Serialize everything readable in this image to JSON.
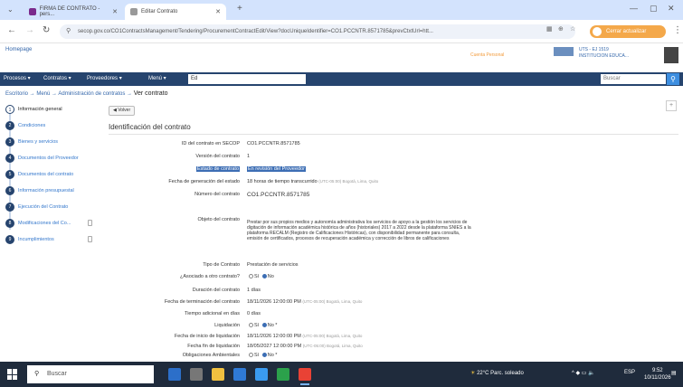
{
  "browser": {
    "tabs": [
      {
        "label": "FIRMA DE CONTRATO - pers...",
        "active": false
      },
      {
        "label": "Editar Contrato",
        "active": true
      }
    ],
    "url": "secop.gov.co/CO1ContractsManagement/Tendering/ProcurementContractEdit/View?docUniqueIdentifier=CO1.PCCNTR.8571785&prevCtxtUrl=htt...",
    "profile_label": "Cerrar actualizar",
    "accent": "#f4a84a"
  },
  "secop": {
    "logo": "Homepage",
    "user_lines": [
      "UTS - EJ 1519",
      "INSTITUCION EDUCA..."
    ],
    "user_links": "Cuenta Personal"
  },
  "nav": {
    "items": [
      "Procesos",
      "Contratos",
      "Proveedores",
      "Menú"
    ],
    "search_value": "Ed",
    "buscar_placeholder": "Buscar",
    "color": "#26446e"
  },
  "breadcrumb": {
    "trail": "Escritorio → Menú → Administración de contratos →",
    "current": "Ver contrato"
  },
  "sidebar": {
    "steps": [
      {
        "n": "1",
        "label": "Información general",
        "active": true,
        "locked": false
      },
      {
        "n": "2",
        "label": "Condiciones",
        "active": false,
        "locked": false
      },
      {
        "n": "3",
        "label": "Bienes y servicios",
        "active": false,
        "locked": false
      },
      {
        "n": "4",
        "label": "Documentos del Proveedor",
        "active": false,
        "locked": false
      },
      {
        "n": "5",
        "label": "Documentos del contrato",
        "active": false,
        "locked": false
      },
      {
        "n": "6",
        "label": "Información presupuestal",
        "active": false,
        "locked": false
      },
      {
        "n": "7",
        "label": "Ejecución del Contrato",
        "active": false,
        "locked": false
      },
      {
        "n": "8",
        "label": "Modificaciones del Co...",
        "active": false,
        "locked": true
      },
      {
        "n": "9",
        "label": "Incumplimientos",
        "active": false,
        "locked": true
      }
    ]
  },
  "main": {
    "back_label": "Volver",
    "collapse_symbol": "+",
    "section_title": "Identificación del contrato",
    "fields": {
      "id_k": "ID del contrato en SECOP",
      "id_v": "CO1.PCCNTR.8571785",
      "version_k": "Versión del contrato",
      "version_v": "1",
      "estado_k": "Estado de contrato",
      "estado_v": "En revisión del Proveedor",
      "fecha_gen_k": "Fecha de generación del estado",
      "fecha_gen_v": "18 horas de tiempo transcurrido",
      "fecha_gen_hint": "(UTC-05:00) Bogotá, Lima, Quito",
      "numero_k": "Número del contrato",
      "numero_v": "CO1.PCCNTR.8571785",
      "objeto_k": "Objeto del contrato",
      "objeto_v": "Prestar por sus propios medios y autonomía administrativa los servicios de apoyo a la gestión los servicios de digitación de información académica histórica de años (historiales) 2017 a 2022 desde la plataforma SNIES a la plataforma RECALM (Registro de Calificaciones Históricas), con disponibilidad permanente para consulta, emisión de certificados, procesos de recuperación académica y corrección de libros de calificaciones",
      "tipo_k": "Tipo de Contrato",
      "tipo_v": "Prestación de servicios",
      "asociado_k": "¿Asociado a otro contrato?",
      "asociado_si": "Sí",
      "asociado_no": "No",
      "duracion_k": "Duración del contrato",
      "duracion_v": "1 días",
      "fecha_term_k": "Fecha de terminación del contrato",
      "fecha_term_v": "18/11/2026 12:00:00 PM",
      "fecha_term_hint": "(UTC-05:00) Bogotá, Lima, Quito",
      "tiempo_k": "Tiempo adicional en días",
      "tiempo_v": "0 días",
      "liquid_k": "Liquidación",
      "liquid_si": "Sí",
      "liquid_no": "No *",
      "fecha_ini_liq_k": "Fecha de inicio de liquidación",
      "fecha_ini_liq_v": "18/11/2026 12:00:00 PM",
      "fecha_ini_liq_hint": "(UTC-05:00) Bogotá, Lima, Quito",
      "fecha_fin_liq_k": "Fecha fin de liquidación",
      "fecha_fin_liq_v": "18/05/2027 12:00:00 PM",
      "fecha_fin_liq_hint": "(UTC-05:00) Bogotá, Lima, Quito",
      "ambient_k": "Obligaciones Ambientales",
      "ambient_si": "Sí",
      "ambient_no": "No *",
      "postcon_k": "Obligaciones pos consumo",
      "postcon_si": "Sí",
      "postcon_no": "No *",
      "reversion_k": "Reversión",
      "reversion_si": "Sí",
      "reversion_no": "No *"
    }
  },
  "taskbar": {
    "search_placeholder": "Buscar",
    "weather": "22°C  Parc. soleado",
    "lang": "ESP",
    "time": "9:52",
    "date": "10/11/2026"
  }
}
